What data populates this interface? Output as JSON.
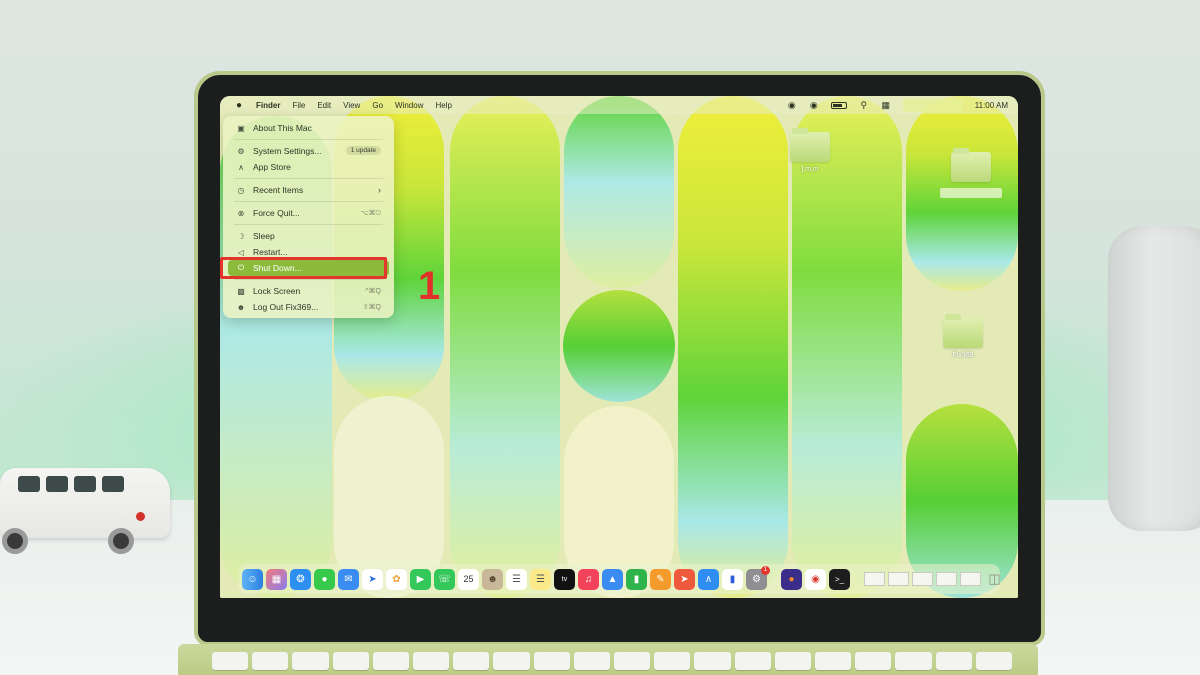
{
  "menubar": {
    "app_name": "Finder",
    "menus": [
      "File",
      "Edit",
      "View",
      "Go",
      "Window",
      "Help"
    ],
    "clock": "11:00 AM"
  },
  "apple_menu": {
    "items": {
      "about": "About This Mac",
      "system_settings": "System Settings...",
      "system_settings_badge": "1 update",
      "app_store": "App Store",
      "recent_items": "Recent Items",
      "force_quit": "Force Quit...",
      "force_quit_shortcut": "⌥⌘⎋",
      "sleep": "Sleep",
      "restart": "Restart...",
      "shut_down": "Shut Down...",
      "lock_screen": "Lock Screen",
      "lock_screen_shortcut": "^⌘Q",
      "log_out": "Log Out Fix369...",
      "log_out_shortcut": "⇧⌘Q"
    },
    "selected": "shut_down"
  },
  "annotation": {
    "step_number": "1"
  },
  "desktop": {
    "folder_1_label": "],m,m",
    "folder_3_label": "Fix369"
  },
  "dock": {
    "calendar_day": "25",
    "badge_count": "1"
  },
  "colors": {
    "highlight": "#e2362c",
    "selection": "#8cbb3c",
    "wallpaper_green": "#5fd43a",
    "wallpaper_yellow": "#e8ec3c",
    "wallpaper_cyan": "#a9e8e8"
  }
}
